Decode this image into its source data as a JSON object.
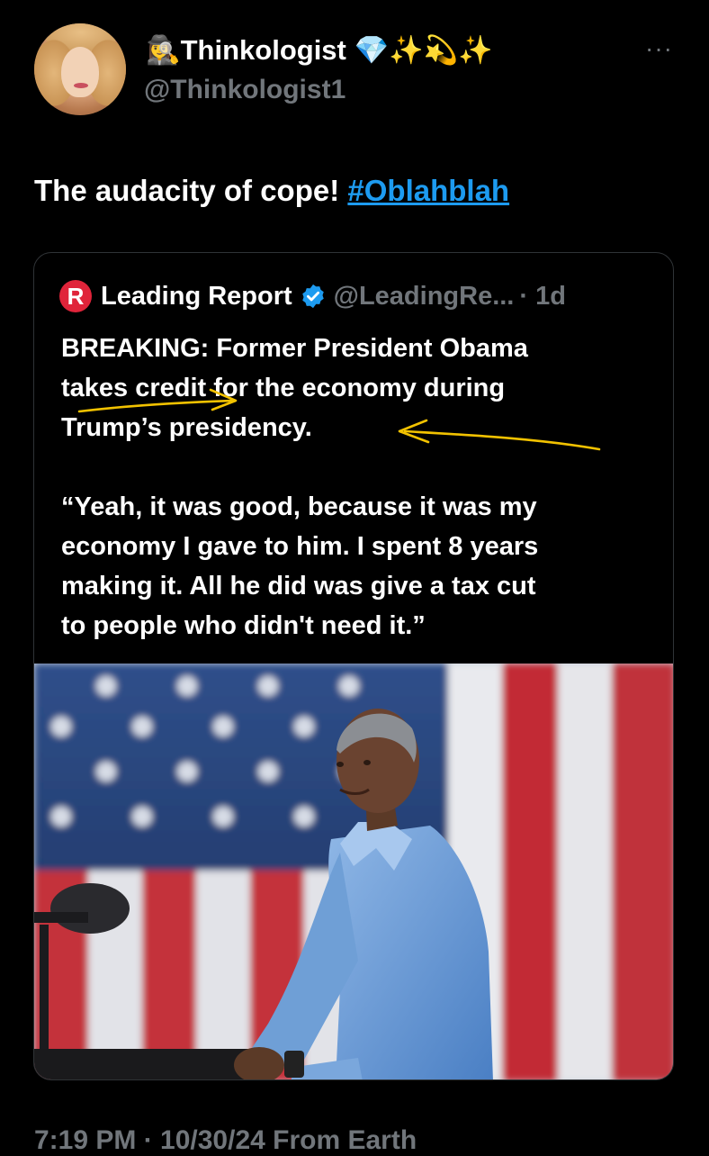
{
  "author": {
    "display_name": "Thinkologist",
    "name_emoji_prefix": "🕵️‍♀️",
    "name_emoji_suffix": "💎✨💫✨",
    "handle": "@Thinkologist1"
  },
  "more_label": "···",
  "tweet": {
    "text": "The audacity of cope! ",
    "hashtag": "#Oblahblah"
  },
  "quote": {
    "logo_letter": "R",
    "name": "Leading Report",
    "handle": "@LeadingRe...",
    "time": "· 1d",
    "verified_color": "#1d9bf0",
    "lines_1": [
      "BREAKING: Former President Obama",
      "takes credit for the economy during",
      "Trump’s presidency."
    ],
    "lines_2": [
      "“Yeah, it was good, because it was my",
      "economy I gave to him. I spent 8 years",
      "making it. All he did was give a tax cut",
      "to people who didn't need it.”"
    ],
    "annotation_color": "#f2c200",
    "image_icon": "photo-obama-flag"
  },
  "footer": {
    "meta": "7:19 PM · 10/30/24 From Earth"
  }
}
